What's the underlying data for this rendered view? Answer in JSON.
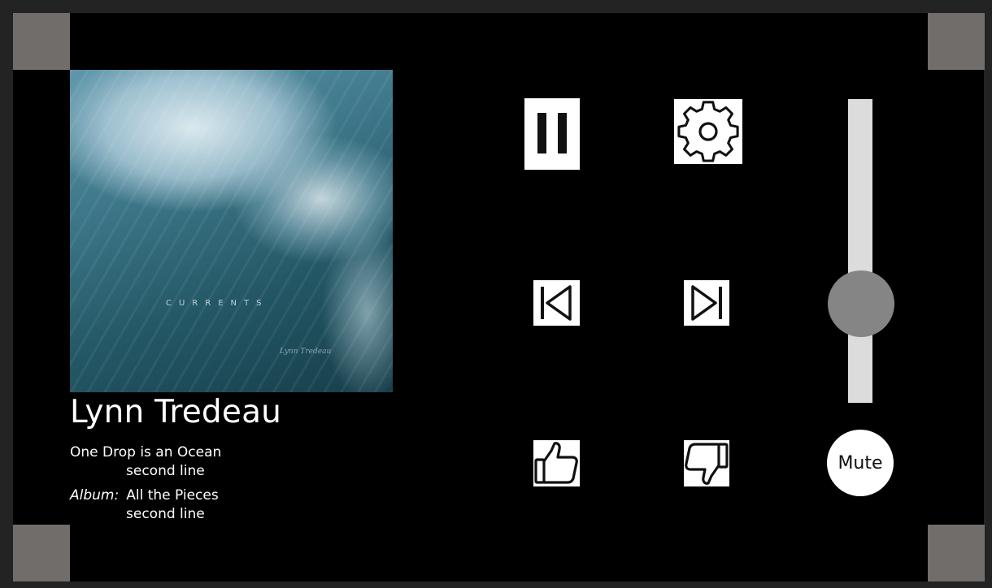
{
  "track": {
    "artist": "Lynn Tredeau",
    "title": "One Drop is an Ocean",
    "title_line2": "second line",
    "album_label": "Album:",
    "album": "All the Pieces",
    "album_line2": "second line"
  },
  "album_art": {
    "title": "CURRENTS",
    "signature": "Lynn Tredeau"
  },
  "controls": {
    "pause_icon": "pause-icon",
    "settings_icon": "gear-icon",
    "previous_icon": "skip-previous-icon",
    "next_icon": "skip-next-icon",
    "like_icon": "thumbs-up-icon",
    "dislike_icon": "thumbs-down-icon",
    "mute_label": "Mute"
  },
  "volume": {
    "level": 0.5
  },
  "colors": {
    "background": "#000000",
    "corner_markers": "#716d6b",
    "volume_track": "#dcdcdc",
    "volume_thumb": "#858585"
  }
}
